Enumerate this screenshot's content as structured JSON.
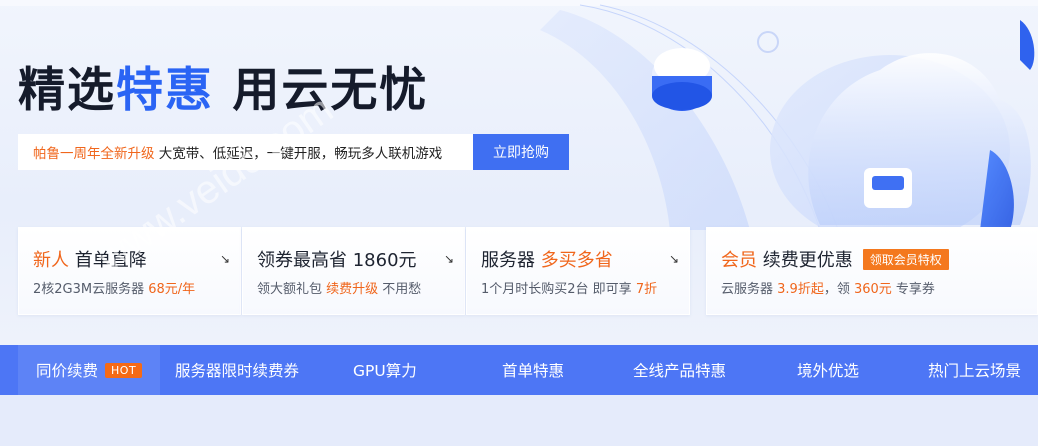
{
  "hero": {
    "headline_part1": "精选",
    "headline_accent": "特惠",
    "headline_part2": " 用云无忧",
    "promo_highlight": "帕鲁一周年全新升级",
    "promo_text": " 大宽带、低延迟，一键开服，畅玩多人联机游戏",
    "buy_button": "立即抢购"
  },
  "cards": [
    {
      "title_a": "新人",
      "title_b": " 首单直降",
      "sub_a": "2核2G3M云服务器",
      "sub_b": " 68元/年",
      "arrow": "↘"
    },
    {
      "title_a": "领券最高省 1860元",
      "sub_a": "领大额礼包 ",
      "sub_b": "续费升级",
      "sub_c": " 不用愁",
      "arrow": "↘"
    },
    {
      "title_a": "服务器 ",
      "title_b": "多买多省",
      "sub_a": "1个月时长购买2台 即可享 ",
      "sub_b": "7折",
      "arrow": "↘"
    },
    {
      "title_a": "会员",
      "title_b": " 续费更优惠",
      "badge": "领取会员特权",
      "sub_a": "云服务器 ",
      "sub_b": "3.9折起",
      "sub_c": "，领 ",
      "sub_d": "360元",
      "sub_e": " 专享券"
    }
  ],
  "nav": {
    "items": [
      "同价续费",
      "服务器限时续费券",
      "GPU算力",
      "首单特惠",
      "全线产品特惠",
      "境外优选",
      "热门上云场景"
    ],
    "hot_badge": "HOT"
  },
  "watermark": "www.veidc.com",
  "colors": {
    "accent_blue": "#2a64f4",
    "button_blue": "#3f6ff2",
    "nav_blue": "#4d76f5",
    "orange": "#f0661c"
  }
}
